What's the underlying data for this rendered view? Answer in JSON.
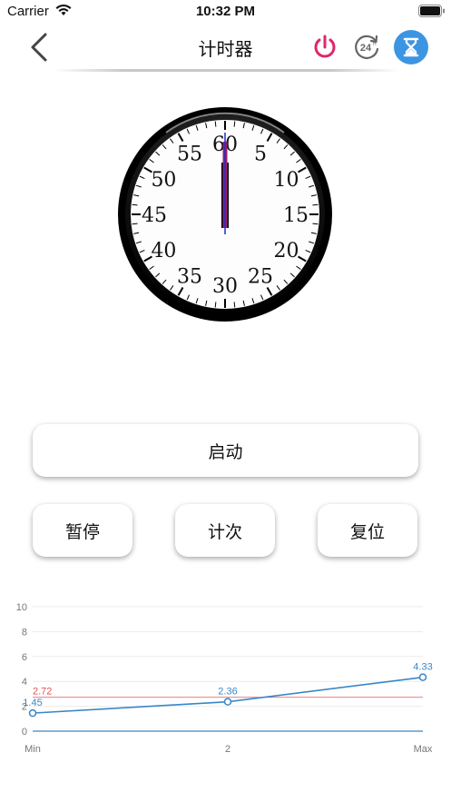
{
  "status_bar": {
    "carrier": "Carrier",
    "time": "10:32 PM"
  },
  "nav": {
    "title": "计时器",
    "h24_label": "24",
    "accent": "#3c95e3",
    "power_color": "#e0256d"
  },
  "clock": {
    "numbers": [
      "60",
      "5",
      "10",
      "15",
      "20",
      "25",
      "30",
      "35",
      "40",
      "45",
      "50",
      "55"
    ],
    "hand_color": "#9b1f6e"
  },
  "buttons": {
    "start": "启动",
    "pause": "暂停",
    "lap": "计次",
    "reset": "复位"
  },
  "chart_data": {
    "type": "line",
    "x": [
      "Min",
      "2",
      "Max"
    ],
    "y_ticks": [
      "0",
      "2",
      "4",
      "6",
      "8",
      "10"
    ],
    "ylim": [
      0,
      10
    ],
    "series": [
      {
        "values": [
          1.45,
          2.36,
          4.33
        ],
        "labels": [
          "1.45",
          "2.36",
          "4.33"
        ],
        "color": "#3a86c8"
      }
    ],
    "reference_line": {
      "value": 2.72,
      "label": "2.72",
      "color": "#e05555"
    },
    "grid": true
  }
}
